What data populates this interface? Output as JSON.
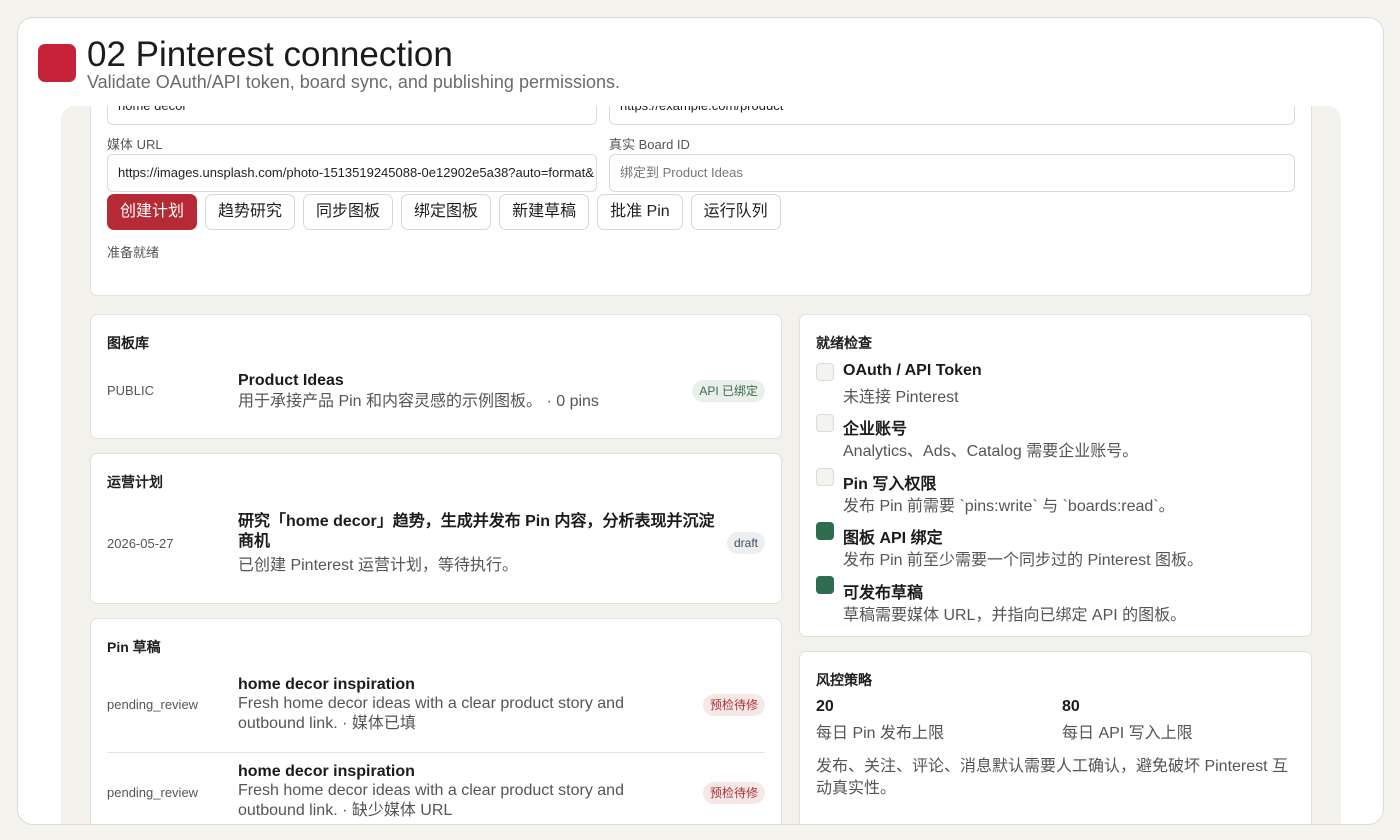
{
  "header": {
    "title": "02 Pinterest connection",
    "subtitle": "Validate OAuth/API token, board sync, and publishing permissions."
  },
  "form": {
    "top_left_value": "home decor",
    "top_right_value": "https://example.com/product",
    "media_url_label": "媒体 URL",
    "media_url_value": "https://images.unsplash.com/photo-1513519245088-0e12902e5a38?auto=format&",
    "board_id_label": "真实 Board ID",
    "board_id_placeholder": "绑定到 Product Ideas",
    "buttons": [
      "创建计划",
      "趋势研究",
      "同步图板",
      "绑定图板",
      "新建草稿",
      "批准 Pin",
      "运行队列"
    ],
    "status": "准备就绪"
  },
  "boards": {
    "title": "图板库",
    "items": [
      {
        "visibility": "PUBLIC",
        "name": "Product Ideas",
        "desc": "用于承接产品 Pin 和内容灵感的示例图板。 · 0 pins",
        "badge": "API 已绑定"
      }
    ]
  },
  "plan": {
    "title": "运营计划",
    "items": [
      {
        "date": "2026-05-27",
        "title": "研究「home decor」趋势，生成并发布 Pin 内容，分析表现并沉淀商机",
        "desc": "已创建 Pinterest 运营计划，等待执行。",
        "badge": "draft"
      }
    ]
  },
  "drafts": {
    "title": "Pin 草稿",
    "items": [
      {
        "status": "pending_review",
        "title": "home decor inspiration",
        "desc": "Fresh home decor ideas with a clear product story and outbound link. · 媒体已填",
        "badge": "预检待修"
      },
      {
        "status": "pending_review",
        "title": "home decor inspiration",
        "desc": "Fresh home decor ideas with a clear product story and outbound link. · 缺少媒体 URL",
        "badge": "预检待修"
      }
    ]
  },
  "readiness": {
    "title": "就绪检查",
    "items": [
      {
        "title": "OAuth / API Token",
        "desc": "未连接 Pinterest",
        "done": false
      },
      {
        "title": "企业账号",
        "desc": "Analytics、Ads、Catalog 需要企业账号。",
        "done": false
      },
      {
        "title": "Pin 写入权限",
        "desc": "发布 Pin 前需要 `pins:write` 与 `boards:read`。",
        "done": false
      },
      {
        "title": "图板 API 绑定",
        "desc": "发布 Pin 前至少需要一个同步过的 Pinterest 图板。",
        "done": true
      },
      {
        "title": "可发布草稿",
        "desc": "草稿需要媒体 URL，并指向已绑定 API 的图板。",
        "done": true
      }
    ]
  },
  "risk": {
    "title": "风控策略",
    "metrics": [
      {
        "value": "20",
        "label": "每日 Pin 发布上限"
      },
      {
        "value": "80",
        "label": "每日 API 写入上限"
      }
    ],
    "policy": "发布、关注、评论、消息默认需要人工确认，避免破坏 Pinterest 互动真实性。"
  },
  "colors": {
    "brand": "#c8223a",
    "primary_button": "#b52a34",
    "check_done": "#2f6b4f"
  }
}
